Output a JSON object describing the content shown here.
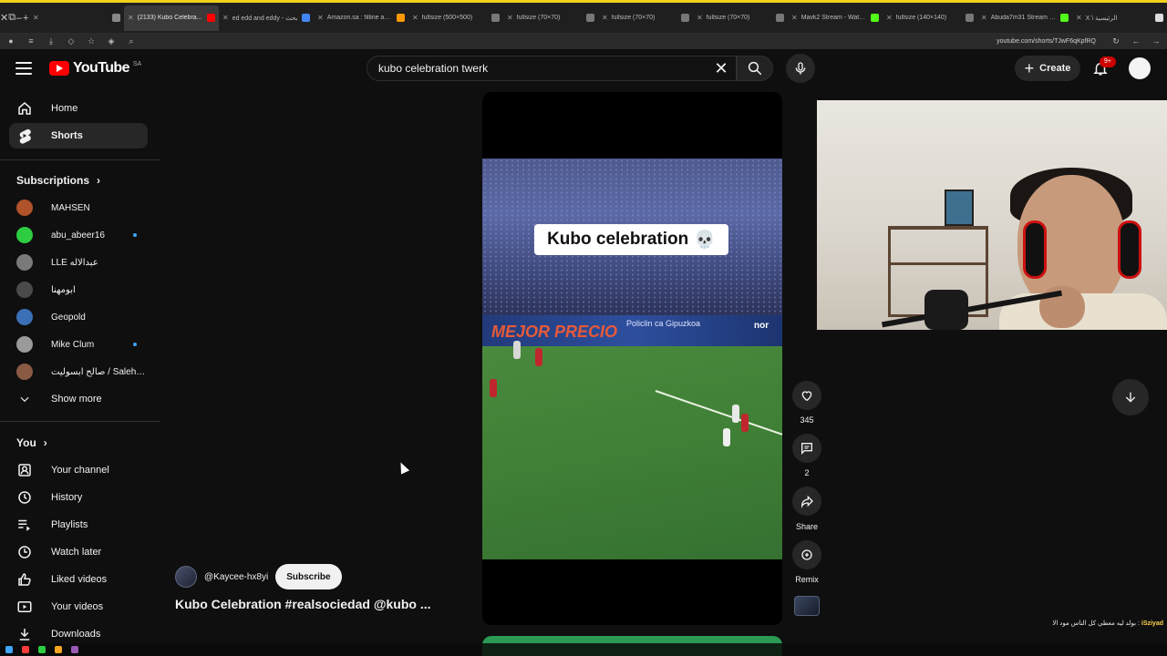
{
  "browser": {
    "tabs": [
      {
        "label": "",
        "favicon": "#888"
      },
      {
        "label": "(2133) Kubo Celebra...",
        "favicon": "#ff0000",
        "active": true
      },
      {
        "label": "ed edd and eddy - بحث",
        "favicon": "#4285f4"
      },
      {
        "label": "Amazon.sa : filline am8",
        "favicon": "#ff9900"
      },
      {
        "label": "fullsize (500×500)",
        "favicon": "#777"
      },
      {
        "label": "fullsize (70×70)",
        "favicon": "#777"
      },
      {
        "label": "fullsize (70×70)",
        "favicon": "#777"
      },
      {
        "label": "fullsize (70×70)",
        "favicon": "#777"
      },
      {
        "label": "Mavk2 Stream - Watch Li",
        "favicon": "#53fc18"
      },
      {
        "label": "fullsize (140×140)",
        "favicon": "#777"
      },
      {
        "label": "Abuda7m31 Stream - Wa",
        "favicon": "#53fc18"
      },
      {
        "label": "X \\ الرئيسية",
        "favicon": "#ddd"
      }
    ],
    "url": "youtube.com/shorts/TJwF6qKpfRQ"
  },
  "header": {
    "logo_text": "YouTube",
    "country_code": "SA",
    "search_value": "kubo celebration twerk",
    "create_label": "Create",
    "notification_count": "9+"
  },
  "sidebar": {
    "main": [
      {
        "label": "Home",
        "icon": "home-icon"
      },
      {
        "label": "Shorts",
        "icon": "shorts-icon",
        "active": true
      }
    ],
    "subscriptions_heading": "Subscriptions",
    "subscriptions": [
      {
        "label": "MAHSEN",
        "color": "#b0522a",
        "live": false
      },
      {
        "label": "abu_abeer16",
        "color": "#2ecc40",
        "live": true
      },
      {
        "label": "LLE عبدالاله",
        "color": "#7a7a7a",
        "live": false
      },
      {
        "label": "ابومهنا",
        "color": "#4a4a4a",
        "live": false
      },
      {
        "label": "Geopold",
        "color": "#3b6fb6",
        "live": false
      },
      {
        "label": "Mike Clum",
        "color": "#9a9a9a",
        "live": true
      },
      {
        "label": "صالح ابسوليت / SalehO...",
        "color": "#8a5a44",
        "live": false
      }
    ],
    "show_more": "Show more",
    "you_heading": "You",
    "you_items": [
      {
        "label": "Your channel",
        "icon": "channel-icon"
      },
      {
        "label": "History",
        "icon": "history-icon"
      },
      {
        "label": "Playlists",
        "icon": "playlists-icon"
      },
      {
        "label": "Watch later",
        "icon": "watch-later-icon"
      },
      {
        "label": "Liked videos",
        "icon": "like-icon"
      },
      {
        "label": "Your videos",
        "icon": "your-videos-icon"
      },
      {
        "label": "Downloads",
        "icon": "download-icon"
      }
    ]
  },
  "short": {
    "overlay_title": "Kubo celebration",
    "overlay_emoji": "💀",
    "board_text_1": "MEJOR PRECIO",
    "board_text_2": "Policlin ca Gipuzkoa",
    "board_text_3": "nor",
    "channel": "@Kaycee-hx8yi",
    "subscribe_label": "Subscribe",
    "title": "Kubo Celebration #realsociedad @kubo ..."
  },
  "actions": {
    "like_count": "345",
    "comment_count": "2",
    "share_label": "Share",
    "remix_label": "Remix"
  },
  "chat": {
    "user": "iSziyad",
    "message": "بولد ليه معطي كل الناس مود الا"
  }
}
